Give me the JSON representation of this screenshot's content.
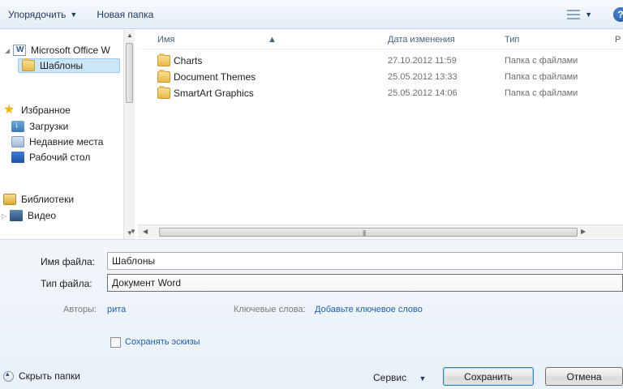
{
  "toolbar": {
    "organize_label": "Упорядочить",
    "new_folder_label": "Новая папка",
    "icons": {
      "organize_caret": "chevron-down-icon",
      "views": "view-list-icon",
      "help": "help-icon"
    },
    "help_glyph": "?"
  },
  "nav": {
    "items": [
      {
        "label": "Microsoft Office W",
        "icon": "word-doc-icon"
      },
      {
        "label": "Шаблоны",
        "icon": "folder-icon",
        "selected": true
      },
      {
        "label": "Избранное",
        "icon": "star-icon"
      },
      {
        "label": "Загрузки",
        "icon": "downloads-icon"
      },
      {
        "label": "Недавние места",
        "icon": "recent-places-icon"
      },
      {
        "label": "Рабочий стол",
        "icon": "desktop-icon"
      },
      {
        "label": "Библиотеки",
        "icon": "libraries-icon"
      },
      {
        "label": "Видео",
        "icon": "video-icon"
      }
    ]
  },
  "filelist": {
    "columns": [
      "Имя",
      "Дата изменения",
      "Тип",
      "Р"
    ],
    "rows": [
      {
        "name": "Charts",
        "date": "27.10.2012 11:59",
        "type": "Папка с файлами"
      },
      {
        "name": "Document Themes",
        "date": "25.05.2012 13:33",
        "type": "Папка с файлами"
      },
      {
        "name": "SmartArt Graphics",
        "date": "25.05.2012 14:06",
        "type": "Папка с файлами"
      }
    ]
  },
  "form": {
    "filename_label": "Имя файла:",
    "filename_value": "Шаблоны",
    "filetype_label": "Тип файла:",
    "filetype_value": "Документ Word",
    "authors_label": "Авторы:",
    "authors_value": "рита",
    "keywords_label": "Ключевые слова:",
    "keywords_value": "Добавьте ключевое слово",
    "thumbnails_label": "Сохранять эскизы",
    "thumbnails_checked": false
  },
  "footer": {
    "hide_folders_label": "Скрыть папки",
    "service_label": "Сервис",
    "save_label": "Сохранить",
    "cancel_label": "Отмена"
  },
  "colors": {
    "toolbar_text": "#1e395b",
    "selection_bg": "#cde6f7",
    "link": "#1f5fb0",
    "panel_bg": "#e9f0f8"
  }
}
